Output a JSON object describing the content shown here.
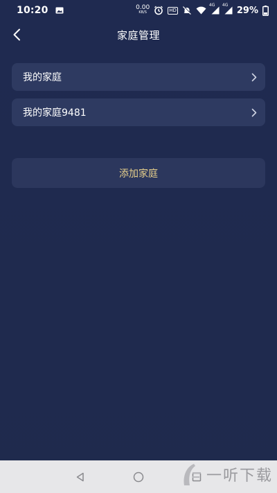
{
  "status_bar": {
    "time": "10:20",
    "net_speed": "0.00",
    "net_unit": "KB/S",
    "hd_label": "HD",
    "signal_label_1": "4G",
    "signal_label_2": "4G",
    "battery_percent": "29%",
    "icons": [
      "image-icon",
      "alarm-icon",
      "mute-icon",
      "wifi-icon",
      "signal-icon",
      "battery-icon"
    ]
  },
  "header": {
    "title": "家庭管理",
    "back_icon": "chevron-left-icon"
  },
  "families": [
    {
      "label": "我的家庭"
    },
    {
      "label": "我的家庭9481"
    }
  ],
  "add_button": {
    "label": "添加家庭"
  },
  "nav_bar": {
    "icons": [
      "back-triangle-icon",
      "home-circle-icon",
      "recents-square-icon"
    ]
  },
  "watermark": {
    "text": "一听下载"
  },
  "colors": {
    "background": "#1f2a4f",
    "card": "#2e3a61",
    "accent_gold": "#e6cf8b",
    "nav_bar": "#e7e7e9"
  }
}
